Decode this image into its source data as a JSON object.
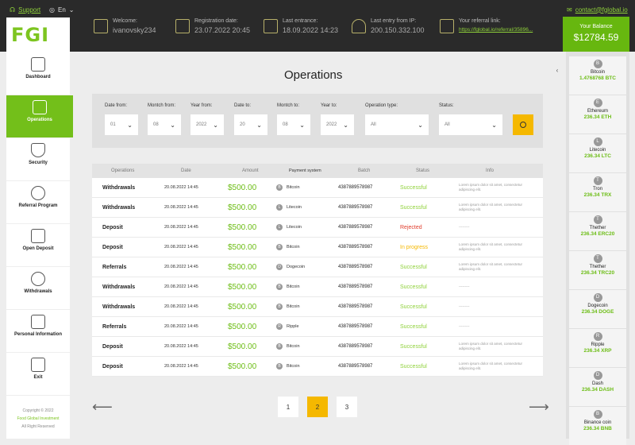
{
  "topbar": {
    "support": "Support",
    "lang": "En",
    "email": "contact@fglobal.io",
    "welcome_label": "Welcome:",
    "welcome_value": "ivanovsky234",
    "reg_label": "Registration date:",
    "reg_value": "23.07.2022 20:45",
    "last_label": "Last entrance:",
    "last_value": "18.09.2022 14:23",
    "ip_label": "Last entry from IP:",
    "ip_value": "200.150.332.100",
    "ref_label": "Your referral link:",
    "ref_value": "https://fglobal.io/referral/35896...",
    "balance_label": "Your Balance",
    "balance_value": "$12784.59"
  },
  "sidebar": {
    "logo": "FGI",
    "items": [
      {
        "label": "Dashboard",
        "icon": "dashboard-icon"
      },
      {
        "label": "Operations",
        "icon": "operations-icon"
      },
      {
        "label": "Security",
        "icon": "shield-icon"
      },
      {
        "label": "Referral Program",
        "icon": "referral-icon"
      },
      {
        "label": "Open Deposit",
        "icon": "deposit-icon"
      },
      {
        "label": "Withdrawals",
        "icon": "withdrawals-icon"
      },
      {
        "label": "Personal Information",
        "icon": "person-icon"
      },
      {
        "label": "Exit",
        "icon": "exit-icon"
      }
    ],
    "copyright_1": "Copyright © 2022",
    "copyright_2": "Food Global Investment",
    "copyright_3": "All Right Reserved"
  },
  "page": {
    "title": "Operations"
  },
  "filters": {
    "date_from_label": "Date from:",
    "date_from": "01",
    "month_from_label": "Montch from:",
    "month_from": "08",
    "year_from_label": "Year from:",
    "year_from": "2022",
    "date_to_label": "Date to:",
    "date_to": "20",
    "month_to_label": "Montch to:",
    "month_to": "08",
    "year_to_label": "Year to:",
    "year_to": "2022",
    "type_label": "Operation type:",
    "type": "All",
    "status_label": "Status:",
    "status": "All"
  },
  "table": {
    "headers": [
      "Operations",
      "Date",
      "Amount",
      "Payment system",
      "Batch",
      "Status",
      "Info"
    ],
    "rows": [
      {
        "op": "Withdrawals",
        "date": "20.08.2022  14:45",
        "amount": "$500.00",
        "coin": "B",
        "system": "Bitcoin",
        "batch": "4387889578987",
        "status": "Successful",
        "info": "Lorem ipsum dolor sit amet, consectetur adipiscing elit."
      },
      {
        "op": "Withdrawals",
        "date": "20.08.2022  14:45",
        "amount": "$500.00",
        "coin": "L",
        "system": "Litecoin",
        "batch": "4387889578987",
        "status": "Successful",
        "info": "Lorem ipsum dolor sit amet, consectetur adipiscing elit."
      },
      {
        "op": "Deposit",
        "date": "20.08.2022  14:45",
        "amount": "$500.00",
        "coin": "L",
        "system": "Litecoin",
        "batch": "4387889578987",
        "status": "Rejected",
        "info": "---------"
      },
      {
        "op": "Deposit",
        "date": "20.08.2022  14:45",
        "amount": "$500.00",
        "coin": "B",
        "system": "Bitcoin",
        "batch": "4387889578987",
        "status": "In progress",
        "info": "Lorem ipsum dolor sit amet, consectetur adipiscing elit."
      },
      {
        "op": "Referrals",
        "date": "20.08.2022  14:45",
        "amount": "$500.00",
        "coin": "D",
        "system": "Dogecoin",
        "batch": "4387889578987",
        "status": "Successful",
        "info": "Lorem ipsum dolor sit amet, consectetur adipiscing elit."
      },
      {
        "op": "Withdrawals",
        "date": "20.08.2022  14:45",
        "amount": "$500.00",
        "coin": "B",
        "system": "Bitcoin",
        "batch": "4387889578987",
        "status": "Successful",
        "info": "---------"
      },
      {
        "op": "Withdrawals",
        "date": "20.08.2022  14:45",
        "amount": "$500.00",
        "coin": "B",
        "system": "Bitcoin",
        "batch": "4387889578987",
        "status": "Successful",
        "info": "---------"
      },
      {
        "op": "Referrals",
        "date": "20.08.2022  14:45",
        "amount": "$500.00",
        "coin": "R",
        "system": "Ripple",
        "batch": "4387889578987",
        "status": "Successful",
        "info": "---------"
      },
      {
        "op": "Deposit",
        "date": "20.08.2022  14:45",
        "amount": "$500.00",
        "coin": "B",
        "system": "Bitcoin",
        "batch": "4387889578987",
        "status": "Successful",
        "info": "Lorem ipsum dolor sit amet, consectetur adipiscing elit."
      },
      {
        "op": "Deposit",
        "date": "20.08.2022  14:45",
        "amount": "$500.00",
        "coin": "B",
        "system": "Bitcoin",
        "batch": "4387889578987",
        "status": "Successful",
        "info": "Lorem ipsum dolor sit amet, consectetur adipiscing elit."
      }
    ]
  },
  "pagination": {
    "pages": [
      "1",
      "2",
      "3"
    ],
    "active": "2"
  },
  "wallets": [
    {
      "name": "Bitcoin",
      "value": "1.4768768 BTC",
      "glyph": "B"
    },
    {
      "name": "Ethereum",
      "value": "236.34 ETH",
      "glyph": "E"
    },
    {
      "name": "Litecoin",
      "value": "236.34 LTC",
      "glyph": "L"
    },
    {
      "name": "Tron",
      "value": "236.34 TRX",
      "glyph": "T"
    },
    {
      "name": "Thether",
      "value": "236.34 ERC20",
      "glyph": "T"
    },
    {
      "name": "Thether",
      "value": "236.34 TRC20",
      "glyph": "T"
    },
    {
      "name": "Dogecoin",
      "value": "236.34 DOGE",
      "glyph": "D"
    },
    {
      "name": "Ripple",
      "value": "236.34 XRP",
      "glyph": "R"
    },
    {
      "name": "Dash",
      "value": "236.34 DASH",
      "glyph": "D"
    },
    {
      "name": "Binance coin",
      "value": "236.34 BNB",
      "glyph": "B"
    }
  ]
}
